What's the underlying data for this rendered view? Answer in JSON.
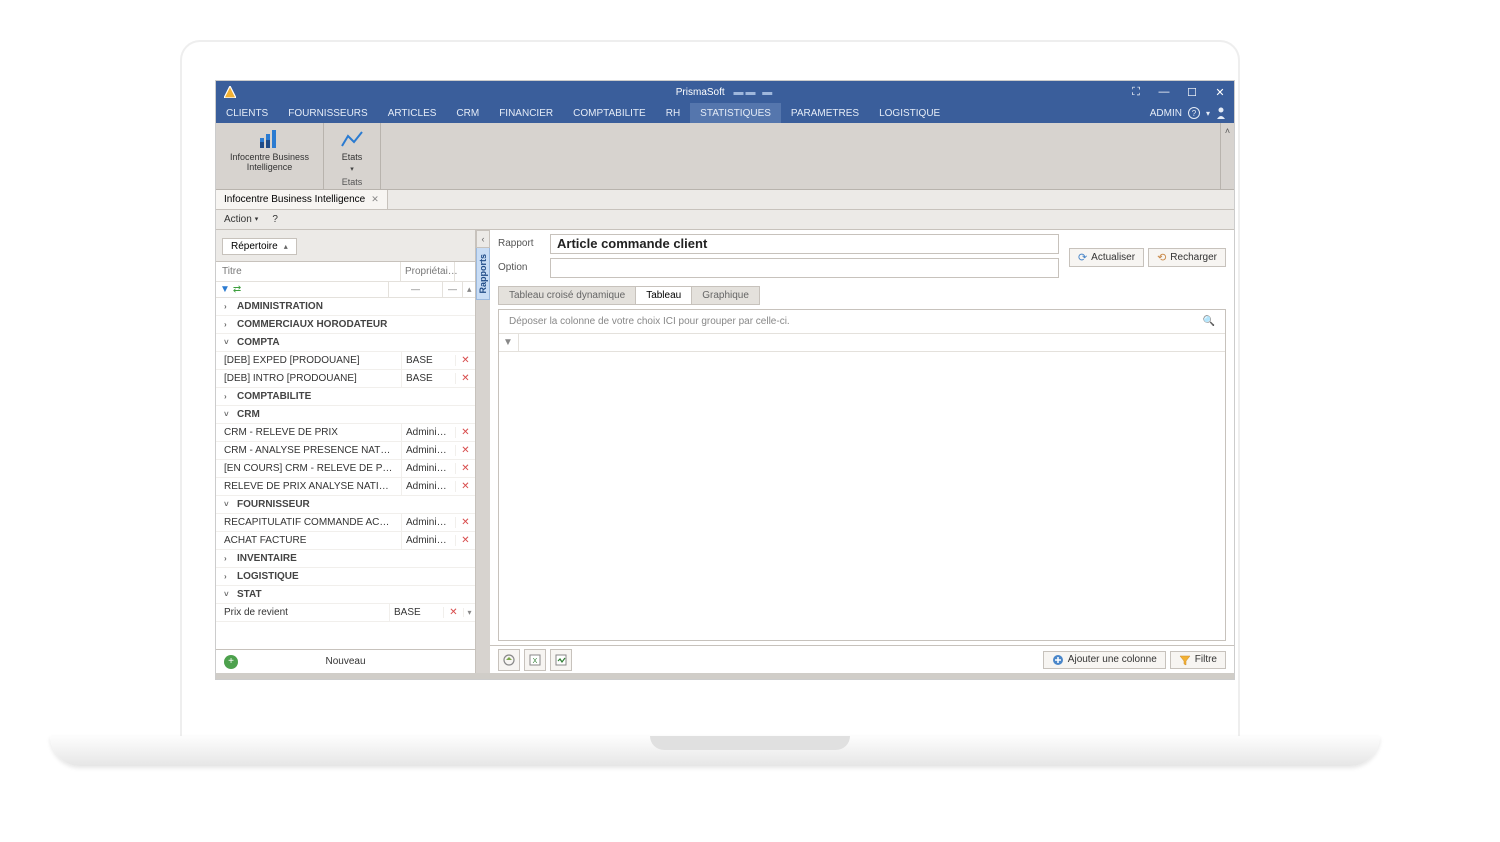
{
  "window": {
    "title_app": "PrismaSoft",
    "title_suffix": "▬▬ ▬"
  },
  "window_buttons": {
    "maximize_alt": "⛶",
    "minimize": "—",
    "restore": "☐",
    "close": "✕"
  },
  "top_menu": {
    "items": [
      "CLIENTS",
      "FOURNISSEURS",
      "ARTICLES",
      "CRM",
      "FINANCIER",
      "COMPTABILITE",
      "RH",
      "STATISTIQUES",
      "PARAMETRES",
      "LOGISTIQUE"
    ],
    "active_index": 7,
    "right_label": "ADMIN"
  },
  "ribbon": {
    "groups": [
      {
        "label": "",
        "buttons": [
          {
            "id": "bi",
            "label": "Infocentre Business\nIntelligence",
            "icon": "bar-chart"
          }
        ]
      },
      {
        "caption": "Etats",
        "buttons": [
          {
            "id": "etats",
            "label": "Etats",
            "icon": "line-chart",
            "dropdown": true
          }
        ]
      }
    ]
  },
  "doc_tab": {
    "label": "Infocentre Business Intelligence"
  },
  "sub_menu": {
    "items": [
      {
        "label": "Action",
        "dropdown": true
      },
      {
        "label": "?"
      }
    ]
  },
  "sidebar": {
    "combo_label": "Répertoire",
    "columns": {
      "title": "Titre",
      "owner": "Propriétai…"
    },
    "filter_row": {
      "title": "—",
      "owner": "—"
    },
    "groups": [
      {
        "name": "ADMINISTRATION",
        "open": false,
        "rows": []
      },
      {
        "name": "COMMERCIAUX HORODATEUR",
        "open": false,
        "rows": []
      },
      {
        "name": "COMPTA",
        "open": true,
        "rows": [
          {
            "title": "[DEB] EXPED [PRODOUANE]",
            "owner": "BASE",
            "fav": true
          },
          {
            "title": "[DEB] INTRO [PRODOUANE]",
            "owner": "BASE",
            "fav": true
          }
        ]
      },
      {
        "name": "COMPTABILITE",
        "open": false,
        "rows": []
      },
      {
        "name": "CRM",
        "open": true,
        "rows": [
          {
            "title": "CRM - RELEVE DE PRIX",
            "owner": "Administr…",
            "fav": true
          },
          {
            "title": "CRM - ANALYSE PRESENCE NATIONALE",
            "owner": "Administr…",
            "fav": true
          },
          {
            "title": "[EN COURS] CRM - RELEVE DE PRIX",
            "owner": "Administr…",
            "fav": true
          },
          {
            "title": "RELEVE DE PRIX ANALYSE NATIONALE",
            "owner": "Administr…",
            "fav": true
          }
        ]
      },
      {
        "name": "FOURNISSEUR",
        "open": true,
        "rows": [
          {
            "title": "RECAPITULATIF COMMANDE ACHAT",
            "owner": "Administr…",
            "fav": true
          },
          {
            "title": "ACHAT FACTURE",
            "owner": "Administr…",
            "fav": true
          }
        ]
      },
      {
        "name": "INVENTAIRE",
        "open": false,
        "rows": []
      },
      {
        "name": "LOGISTIQUE",
        "open": false,
        "rows": []
      },
      {
        "name": "STAT",
        "open": true,
        "rows": [
          {
            "title": "Prix de revient",
            "owner": "BASE",
            "fav": true
          }
        ]
      }
    ],
    "footer_new": "Nouveau"
  },
  "collapse": {
    "vertical_tab": "Rapports"
  },
  "report": {
    "field_rapport_label": "Rapport",
    "field_option_label": "Option",
    "title": "Article commande client",
    "btn_refresh": "Actualiser",
    "btn_reload": "Recharger",
    "tabs": [
      "Tableau croisé dynamique",
      "Tableau",
      "Graphique"
    ],
    "active_tab_index": 1,
    "group_hint": "Déposer la colonne de votre choix ICI pour grouper par celle-ci."
  },
  "footer": {
    "btn_add_column": "Ajouter une colonne",
    "btn_filter": "Filtre"
  }
}
